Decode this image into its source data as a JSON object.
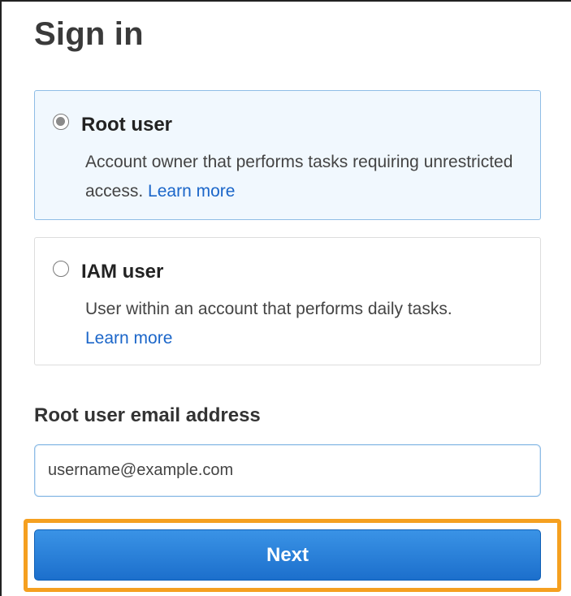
{
  "page": {
    "title": "Sign in"
  },
  "options": [
    {
      "label": "Root user",
      "description": "Account owner that performs tasks requiring unrestricted access.",
      "link": "Learn more",
      "selected": true
    },
    {
      "label": "IAM user",
      "description": "User within an account that performs daily tasks.",
      "link": "Learn more",
      "selected": false
    }
  ],
  "email_field": {
    "label": "Root user email address",
    "placeholder": "username@example.com",
    "value": ""
  },
  "next_button": {
    "label": "Next"
  },
  "colors": {
    "accent": "#1b66c9",
    "selected_bg": "#f1f8fe",
    "selected_border": "#8fbde6",
    "highlight": "#f5a020",
    "button": "#2a80d8"
  }
}
